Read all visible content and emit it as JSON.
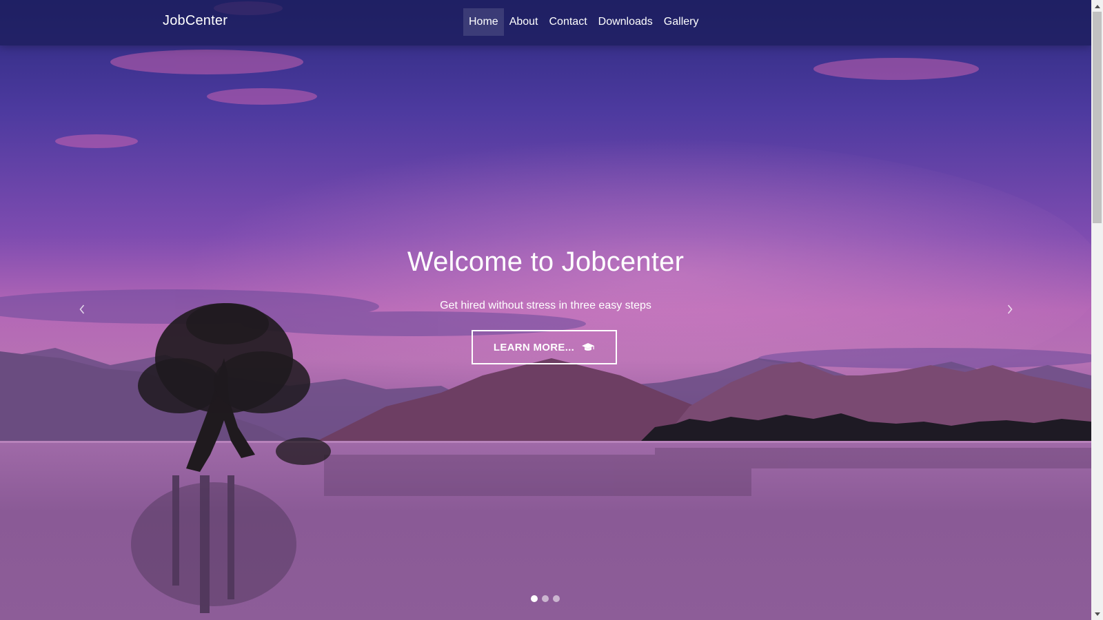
{
  "navbar": {
    "brand": "JobCenter",
    "items": [
      {
        "label": "Home",
        "active": true
      },
      {
        "label": "About"
      },
      {
        "label": "Contact"
      },
      {
        "label": "Downloads"
      },
      {
        "label": "Gallery"
      }
    ]
  },
  "hero": {
    "title": "Welcome to Jobcenter",
    "subtitle": "Get hired without stress in three easy steps",
    "cta_label": "LEARN MORE...",
    "cta_icon": "graduation-cap-icon",
    "prev_icon": "chevron-left-icon",
    "next_icon": "chevron-right-icon"
  },
  "carousel": {
    "slide_count": 3,
    "active_index": 0
  },
  "colors": {
    "navbar_bg": "#1c1e5c",
    "text": "#ffffff"
  }
}
